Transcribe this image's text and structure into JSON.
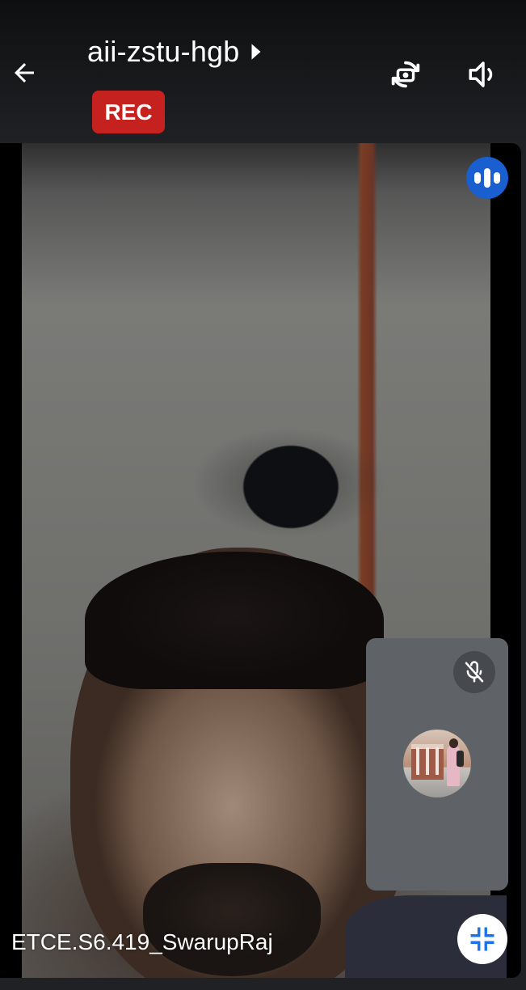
{
  "header": {
    "meeting_code": "aii-zstu-hgb",
    "recording_badge": "REC",
    "icons": {
      "back": "arrow-back-icon",
      "expand": "caret-right-icon",
      "switch_camera": "switch-camera-icon",
      "audio": "volume-up-icon"
    }
  },
  "main_video": {
    "participant_name": "ETCE.S6.419_SwarupRaj",
    "speaking_icon": "audio-level-icon",
    "collapse_icon": "collapse-icon"
  },
  "self_view": {
    "mic_icon": "mic-off-icon",
    "avatar": "user-avatar"
  },
  "colors": {
    "accent_blue": "#1a5fd0",
    "rec_red": "#c5221f",
    "tile_gray": "#5f6368",
    "collapse_icon_blue": "#1a73e8"
  }
}
